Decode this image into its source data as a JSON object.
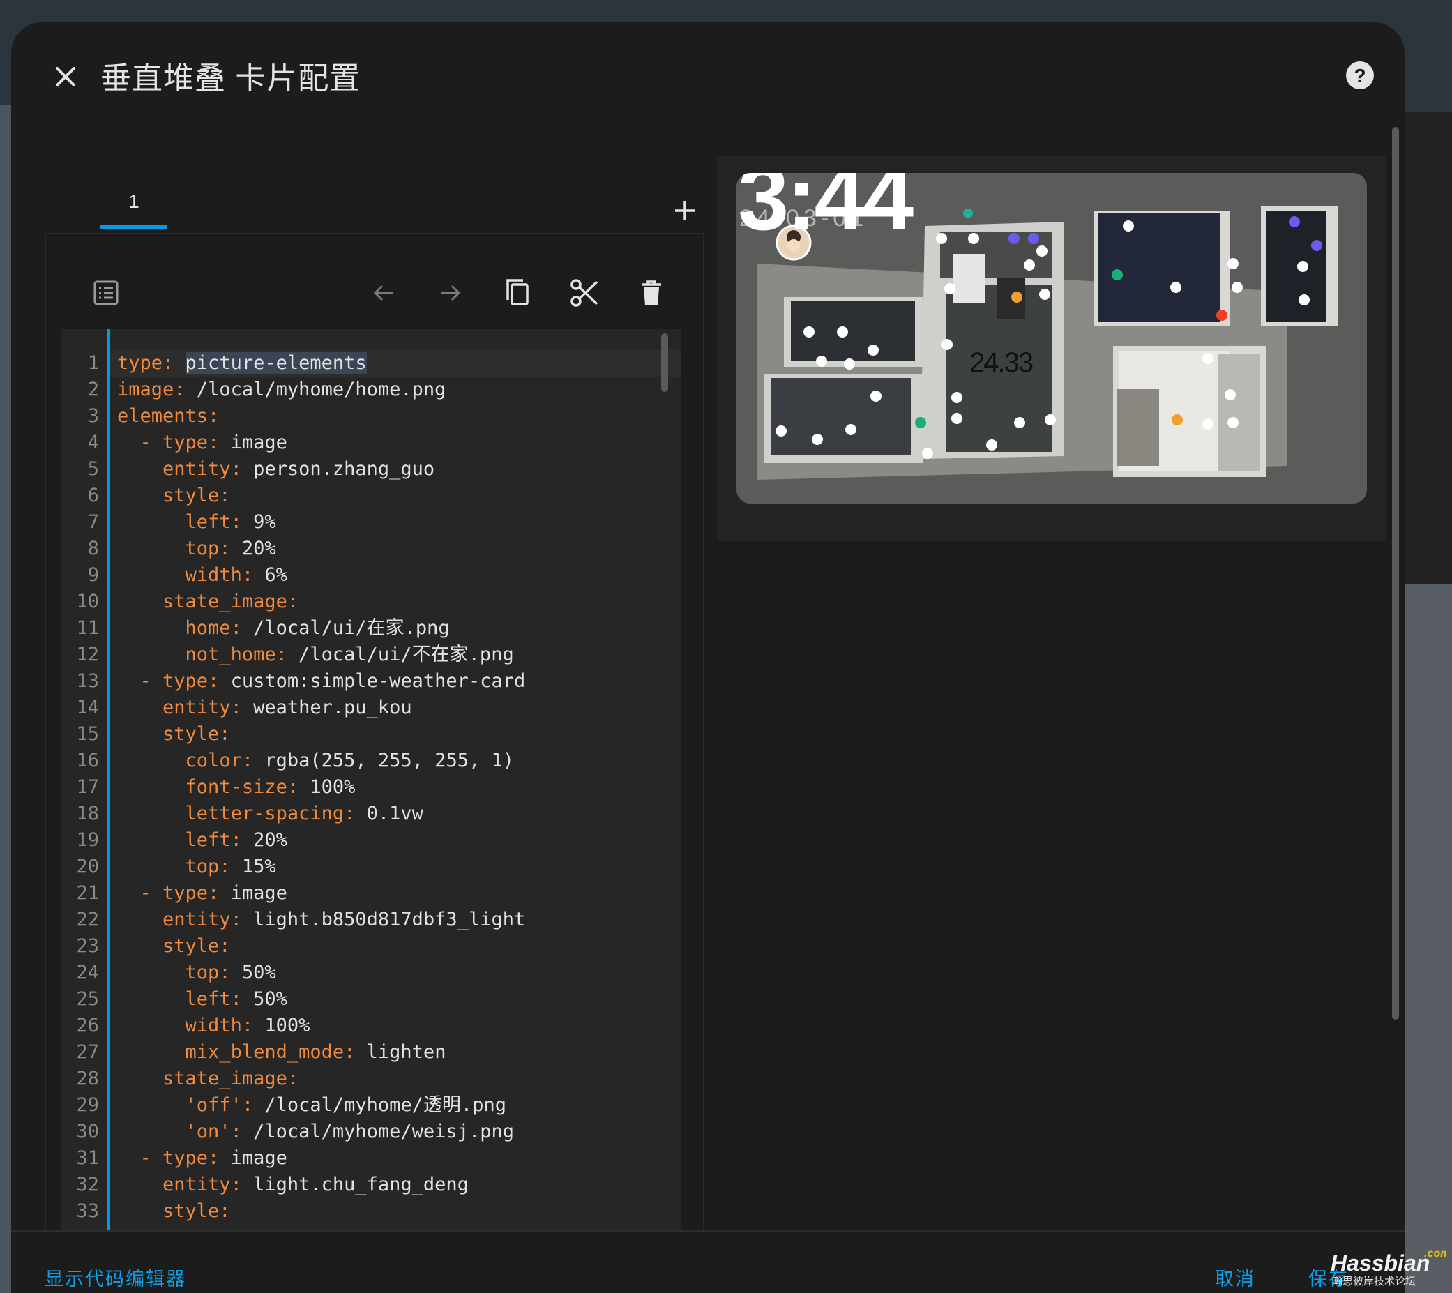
{
  "dialog": {
    "title": "垂直堆叠 卡片配置",
    "close_icon": "close-icon",
    "help_icon": "help-icon"
  },
  "tabs": [
    {
      "label": "1"
    }
  ],
  "toolbar": {
    "icons": [
      "list-icon",
      "arrow-left-icon",
      "arrow-right-icon",
      "copy-icon",
      "cut-icon",
      "delete-icon"
    ]
  },
  "editor": {
    "lines": [
      {
        "n": "1",
        "key": "type",
        "val": "picture-elements",
        "current": true
      },
      {
        "n": "2",
        "key": "image",
        "val": "/local/myhome/home.png"
      },
      {
        "n": "3",
        "key": "elements",
        "val": ""
      },
      {
        "n": "4",
        "indent": "  - ",
        "key": "type",
        "val": "image"
      },
      {
        "n": "5",
        "indent": "    ",
        "key": "entity",
        "val": "person.zhang_guo"
      },
      {
        "n": "6",
        "indent": "    ",
        "key": "style",
        "val": ""
      },
      {
        "n": "7",
        "indent": "      ",
        "key": "left",
        "val": "9%"
      },
      {
        "n": "8",
        "indent": "      ",
        "key": "top",
        "val": "20%"
      },
      {
        "n": "9",
        "indent": "      ",
        "key": "width",
        "val": "6%"
      },
      {
        "n": "10",
        "indent": "    ",
        "key": "state_image",
        "val": ""
      },
      {
        "n": "11",
        "indent": "      ",
        "key": "home",
        "val": "/local/ui/在家.png"
      },
      {
        "n": "12",
        "indent": "      ",
        "key": "not_home",
        "val": "/local/ui/不在家.png"
      },
      {
        "n": "13",
        "indent": "  - ",
        "key": "type",
        "val": "custom:simple-weather-card"
      },
      {
        "n": "14",
        "indent": "    ",
        "key": "entity",
        "val": "weather.pu_kou"
      },
      {
        "n": "15",
        "indent": "    ",
        "key": "style",
        "val": ""
      },
      {
        "n": "16",
        "indent": "      ",
        "key": "color",
        "val": "rgba(255, 255, 255, 1)"
      },
      {
        "n": "17",
        "indent": "      ",
        "key": "font-size",
        "val": "100%"
      },
      {
        "n": "18",
        "indent": "      ",
        "key": "letter-spacing",
        "val": "0.1vw"
      },
      {
        "n": "19",
        "indent": "      ",
        "key": "left",
        "val": "20%"
      },
      {
        "n": "20",
        "indent": "      ",
        "key": "top",
        "val": "15%"
      },
      {
        "n": "21",
        "indent": "  - ",
        "key": "type",
        "val": "image"
      },
      {
        "n": "22",
        "indent": "    ",
        "key": "entity",
        "val": "light.b850d817dbf3_light"
      },
      {
        "n": "23",
        "indent": "    ",
        "key": "style",
        "val": ""
      },
      {
        "n": "24",
        "indent": "      ",
        "key": "top",
        "val": "50%"
      },
      {
        "n": "25",
        "indent": "      ",
        "key": "left",
        "val": "50%"
      },
      {
        "n": "26",
        "indent": "      ",
        "key": "width",
        "val": "100%"
      },
      {
        "n": "27",
        "indent": "      ",
        "key": "mix_blend_mode",
        "val": "lighten"
      },
      {
        "n": "28",
        "indent": "    ",
        "key": "state_image",
        "val": ""
      },
      {
        "n": "29",
        "indent": "      ",
        "key": "'off'",
        "val": "/local/myhome/透明.png"
      },
      {
        "n": "30",
        "indent": "      ",
        "key": "'on'",
        "val": "/local/myhome/weisj.png"
      },
      {
        "n": "31",
        "indent": "  - ",
        "key": "type",
        "val": "image"
      },
      {
        "n": "32",
        "indent": "    ",
        "key": "entity",
        "val": "light.chu_fang_deng"
      },
      {
        "n": "33",
        "indent": "    ",
        "key": "style",
        "val": ""
      }
    ]
  },
  "preview": {
    "clock": "3:44",
    "date": "24-03-01",
    "temperature": "24.33"
  },
  "footer": {
    "show_code_editor": "显示代码编辑器",
    "cancel": "取消",
    "save": "保存"
  },
  "watermark": {
    "brand": "Hassbian",
    "suffix": ".com",
    "tagline": "瀚思彼岸技术论坛"
  },
  "colors": {
    "accent": "#039be5",
    "yaml_key": "#f08a3c",
    "background": "#1c1c1c"
  }
}
